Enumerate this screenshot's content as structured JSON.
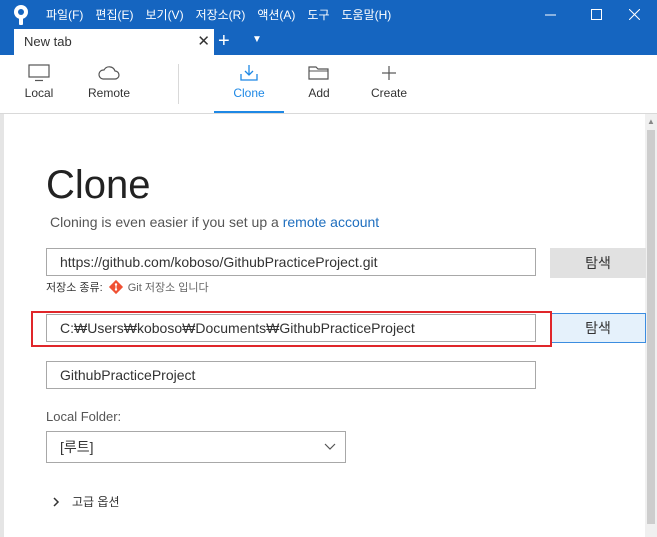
{
  "menu": [
    "파일(F)",
    "편집(E)",
    "보기(V)",
    "저장소(R)",
    "액션(A)",
    "도구",
    "도움말(H)"
  ],
  "window": {
    "minimize": "—",
    "maximize": "☐",
    "close": "✕"
  },
  "tab": {
    "label": "New tab",
    "close": "✕",
    "new": "+",
    "menu": "▼"
  },
  "toolbar": {
    "local": "Local",
    "remote": "Remote",
    "clone": "Clone",
    "add": "Add",
    "create": "Create"
  },
  "page": {
    "title": "Clone",
    "subtitle": "Cloning is even easier if you set up a",
    "subtitle_link": "remote account"
  },
  "source": {
    "value": "https://github.com/koboso/GithubPracticeProject.git",
    "browse": "탐색",
    "repo_type_label": "저장소 종류:",
    "repo_type_value": "Git 저장소 입니다"
  },
  "destination": {
    "value": "C:₩Users₩koboso₩Documents₩GithubPracticeProject",
    "browse": "탐색"
  },
  "name": {
    "value": "GithubPracticeProject"
  },
  "local_folder": {
    "label": "Local Folder:",
    "value": "[루트]"
  },
  "advanced": {
    "label": "고급 옵션"
  },
  "colors": {
    "accent": "#1565c0",
    "active_tab": "#1e88e5",
    "highlight_box": "#e0262a"
  }
}
